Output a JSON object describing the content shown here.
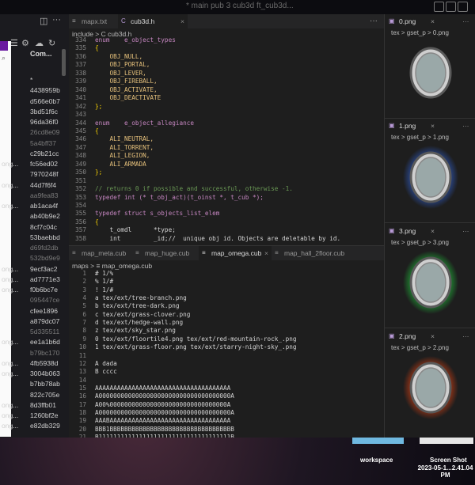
{
  "top_bar": {
    "faded_title": "* main pub 3 cub3d ft_cub3d..."
  },
  "sidebar": {
    "git_col_header": "Com...",
    "git_rows": [
      {
        "branch": "",
        "hash": "*",
        "dim": false
      },
      {
        "branch": "",
        "hash": "4438959b",
        "dim": false
      },
      {
        "branch": "",
        "hash": "d566e0b7",
        "dim": false
      },
      {
        "branch": "",
        "hash": "3bd51f6c",
        "dim": false
      },
      {
        "branch": "",
        "hash": "96da36f0",
        "dim": false
      },
      {
        "branch": "",
        "hash": "26cd8e09",
        "dim": true
      },
      {
        "branch": "",
        "hash": "5a4bff37",
        "dim": true
      },
      {
        "branch": "",
        "hash": "c29b21cc",
        "dim": false
      },
      {
        "branch": "ong...",
        "hash": "fc56ed02",
        "dim": false
      },
      {
        "branch": "",
        "hash": "7970248f",
        "dim": false
      },
      {
        "branch": "ong...",
        "hash": "44d7f6f4",
        "dim": false
      },
      {
        "branch": "",
        "hash": "aa9fea83",
        "dim": true
      },
      {
        "branch": "ong...",
        "hash": "ab1aca4f",
        "dim": false
      },
      {
        "branch": "",
        "hash": "ab40b9e2",
        "dim": false
      },
      {
        "branch": "",
        "hash": "8cf7c04c",
        "dim": false
      },
      {
        "branch": "",
        "hash": "53baebbd",
        "dim": false
      },
      {
        "branch": "",
        "hash": "d69fd2db",
        "dim": true
      },
      {
        "branch": "",
        "hash": "532bd9e9",
        "dim": true
      },
      {
        "branch": "ong...",
        "hash": "9ecf3ac2",
        "dim": false
      },
      {
        "branch": "ong...",
        "hash": "ad7771e3",
        "dim": false
      },
      {
        "branch": "ong...",
        "hash": "f0b6bc7e",
        "dim": false
      },
      {
        "branch": "",
        "hash": "095447ce",
        "dim": true
      },
      {
        "branch": "",
        "hash": "cfee1896",
        "dim": false
      },
      {
        "branch": "",
        "hash": "a879dc07",
        "dim": false
      },
      {
        "branch": "",
        "hash": "5d335511",
        "dim": true
      },
      {
        "branch": "ong...",
        "hash": "ee1a1b6d",
        "dim": false
      },
      {
        "branch": "",
        "hash": "b79bc170",
        "dim": true
      },
      {
        "branch": "ong...",
        "hash": "4fb5938d",
        "dim": false
      },
      {
        "branch": "ong...",
        "hash": "3004b063",
        "dim": false
      },
      {
        "branch": "",
        "hash": "b7bb78ab",
        "dim": false
      },
      {
        "branch": "",
        "hash": "822c705e",
        "dim": false
      },
      {
        "branch": "ong...",
        "hash": "8d3ffb01",
        "dim": false
      },
      {
        "branch": "ong...",
        "hash": "1260bf2e",
        "dim": false
      },
      {
        "branch": "ong...",
        "hash": "e82db329",
        "dim": false
      }
    ]
  },
  "editor_top": {
    "tabs": [
      {
        "label": "mapx.txt",
        "icon": "≡",
        "active": false
      },
      {
        "label": "cub3d.h",
        "icon": "C",
        "active": true
      }
    ],
    "breadcrumb": "include  >  C  cub3d.h",
    "lines": [
      {
        "n": "334",
        "t": "enum    e_object_types"
      },
      {
        "n": "335",
        "t": "{"
      },
      {
        "n": "336",
        "t": "    OBJ_NULL,"
      },
      {
        "n": "337",
        "t": "    OBJ_PORTAL,"
      },
      {
        "n": "338",
        "t": "    OBJ_LEVER,"
      },
      {
        "n": "339",
        "t": "    OBJ_FIREBALL,"
      },
      {
        "n": "340",
        "t": "    OBJ_ACTIVATE,"
      },
      {
        "n": "341",
        "t": "    OBJ_DEACTIVATE"
      },
      {
        "n": "342",
        "t": "};"
      },
      {
        "n": "343",
        "t": ""
      },
      {
        "n": "344",
        "t": "enum    e_object_allegiance"
      },
      {
        "n": "345",
        "t": "{"
      },
      {
        "n": "346",
        "t": "    ALI_NEUTRAL,"
      },
      {
        "n": "347",
        "t": "    ALI_TORRENT,"
      },
      {
        "n": "348",
        "t": "    ALI_LEGION,"
      },
      {
        "n": "349",
        "t": "    ALI_ARMADA"
      },
      {
        "n": "350",
        "t": "};"
      },
      {
        "n": "351",
        "t": ""
      },
      {
        "n": "352",
        "t": "// returns 0 if possible and successful, otherwise -1."
      },
      {
        "n": "353",
        "t": "typedef int (* t_obj_act)(t_oinst *, t_cub *);"
      },
      {
        "n": "354",
        "t": ""
      },
      {
        "n": "355",
        "t": "typedef struct s_objects_list_elem"
      },
      {
        "n": "356",
        "t": "{"
      },
      {
        "n": "357",
        "t": "    t_omdl      *type;"
      },
      {
        "n": "358",
        "t": "    int         _id;//  unique obj id. Objects are deletable by id."
      }
    ]
  },
  "editor_bottom": {
    "tabs": [
      {
        "label": "map_meta.cub",
        "active": false
      },
      {
        "label": "map_huge.cub",
        "active": false
      },
      {
        "label": "map_omega.cub",
        "active": true
      },
      {
        "label": "map_hall_2floor.cub",
        "active": false
      }
    ],
    "breadcrumb": "maps  >  ≡  map_omega.cub",
    "lines": [
      {
        "n": "1",
        "t": "# 1/%"
      },
      {
        "n": "2",
        "t": "% 1/#"
      },
      {
        "n": "3",
        "t": "! 1/#"
      },
      {
        "n": "4",
        "t": "a tex/ext/tree-branch.png"
      },
      {
        "n": "5",
        "t": "b tex/ext/tree-dark.png"
      },
      {
        "n": "6",
        "t": "c tex/ext/grass-clover.png"
      },
      {
        "n": "7",
        "t": "d tex/ext/hedge-wall.png"
      },
      {
        "n": "8",
        "t": "z tex/ext/sky_star.png"
      },
      {
        "n": "9",
        "t": "0 tex/ext/floortile4.png tex/ext/red-mountain-rock_.png"
      },
      {
        "n": "10",
        "t": "1 tex/ext/grass-floor.png tex/ext/starry-night-sky_.png"
      },
      {
        "n": "11",
        "t": ""
      },
      {
        "n": "12",
        "t": "A dada"
      },
      {
        "n": "13",
        "t": "B cccc"
      },
      {
        "n": "14",
        "t": ""
      },
      {
        "n": "15",
        "t": "AAAAAAAAAAAAAAAAAAAAAAAAAAAAAAAAAAAAA"
      },
      {
        "n": "16",
        "t": "A000000000000000000000000000000000000A"
      },
      {
        "n": "17",
        "t": "A00%00000000000000000000000000000000A"
      },
      {
        "n": "18",
        "t": "A000000000000000000000000000000000000A"
      },
      {
        "n": "19",
        "t": "AAABAAAAAAAAAAAAAAAAAAAAAAAAAAAAAAAAA"
      },
      {
        "n": "20",
        "t": "BBB1BBBBBBBBBBBBBBBBBBBBBBBBBBBBBBBBBB"
      },
      {
        "n": "21",
        "t": "B111111111111111111111111111111111111B"
      }
    ]
  },
  "previews": [
    {
      "tab": "0.png",
      "crumb": "tex  >  gset_p  >  0.png",
      "glow": "#777777"
    },
    {
      "tab": "1.png",
      "crumb": "tex  >  gset_p  >  1.png",
      "glow": "#2f5fd0"
    },
    {
      "tab": "3.png",
      "crumb": "tex  >  gset_p  >  3.png",
      "glow": "#1fc23a"
    },
    {
      "tab": "2.png",
      "crumb": "tex  >  gset_p  >  2.png",
      "glow": "#e04010"
    }
  ],
  "dock": {
    "workspace_label": "workspace",
    "screenshot_label_1": "Screen Shot",
    "screenshot_label_2": "2023-05-1...2.41.04 PM"
  },
  "colors": {
    "keyword": "#c586c0",
    "comment": "#6a9955",
    "enum_value": "#e5c07b"
  }
}
